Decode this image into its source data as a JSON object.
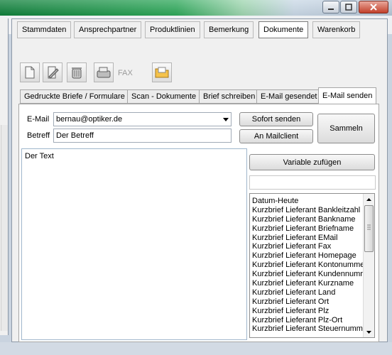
{
  "window": {
    "controls": {
      "minimize": "minimize-icon",
      "maximize": "maximize-icon",
      "close": "close-icon"
    }
  },
  "top_tabs": [
    {
      "label": "Stammdaten"
    },
    {
      "label": "Ansprechpartner"
    },
    {
      "label": "Produktlinien"
    },
    {
      "label": "Bemerkung"
    },
    {
      "label": "Dokumente",
      "active": true
    },
    {
      "label": "Warenkorb"
    }
  ],
  "toolbar": {
    "icons": [
      "new-document-icon",
      "edit-document-icon",
      "trash-icon",
      "fax-machine-icon",
      "folder-icon"
    ],
    "fax_label": "FAX"
  },
  "sub_tabs": [
    {
      "label": "Gedruckte Briefe / Formulare"
    },
    {
      "label": "Scan - Dokumente"
    },
    {
      "label": "Brief schreiben"
    },
    {
      "label": "E-Mail gesendet"
    },
    {
      "label": "E-Mail senden",
      "active": true
    }
  ],
  "email_form": {
    "email_label": "E-Mail",
    "email_value": "bernau@optiker.de",
    "subject_label": "Betreff",
    "subject_value": "Der Betreff",
    "body_value": "Der Text",
    "send_now_button": "Sofort senden",
    "mail_client_button": "An Mailclient",
    "collect_button": "Sammeln",
    "add_variable_button": "Variable zufügen"
  },
  "variables": [
    "Datum-Heute",
    "Kurzbrief Lieferant Bankleitzahl",
    "Kurzbrief Lieferant Bankname",
    "Kurzbrief Lieferant Briefname",
    "Kurzbrief Lieferant EMail",
    "Kurzbrief Lieferant Fax",
    "Kurzbrief Lieferant Homepage",
    "Kurzbrief Lieferant Kontonummer",
    "Kurzbrief Lieferant Kundennummer",
    "Kurzbrief Lieferant Kurzname",
    "Kurzbrief Lieferant Land",
    "Kurzbrief Lieferant Ort",
    "Kurzbrief Lieferant Plz",
    "Kurzbrief Lieferant Plz-Ort",
    "Kurzbrief Lieferant Steuernummer"
  ],
  "colors": {
    "titlebar_green": "#0e7f3a",
    "panel_bg": "#f0f0f0",
    "close_red": "#c2402a"
  }
}
